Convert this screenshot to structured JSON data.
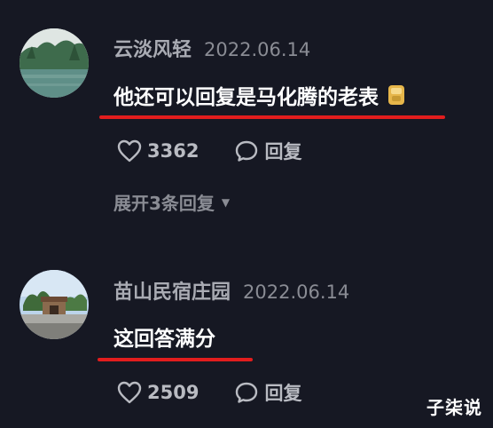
{
  "comments": [
    {
      "username": "云淡风轻",
      "date": "2022.06.14",
      "text": "他还可以回复是马化腾的老表",
      "emoji": "face-emoji-icon",
      "likes": "3362",
      "reply_label": "回复",
      "expand_label": "展开3条回复"
    },
    {
      "username": "苗山民宿庄园",
      "date": "2022.06.14",
      "text": "这回答满分",
      "likes": "2509",
      "reply_label": "回复"
    }
  ],
  "watermark": "子柒说",
  "colors": {
    "background": "#161823",
    "underline": "#e21d1d",
    "text": "#ffffff",
    "meta": "#a9abb3"
  }
}
